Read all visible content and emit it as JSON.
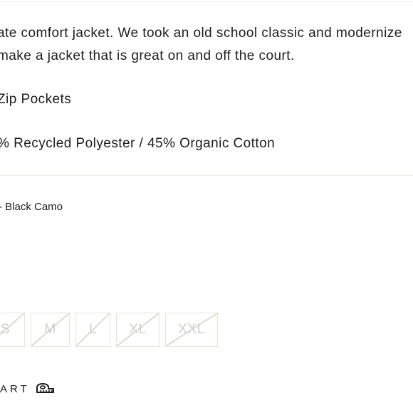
{
  "product": {
    "description_lines": [
      "ate comfort jacket.  We took an old school classic and modernize",
      "make a jacket that is great on and off the court.",
      "Zip Pockets",
      "% Recycled Polyester / 45% Organic Cotton"
    ],
    "color_label": "- Black Camo",
    "sizes": [
      {
        "label": "S",
        "available": false
      },
      {
        "label": "M",
        "available": false
      },
      {
        "label": "L",
        "available": false
      },
      {
        "label": "XL",
        "available": false
      },
      {
        "label": "XXL",
        "available": false
      }
    ],
    "size_chart_label": "ART",
    "size_chart_icon": "ruler-icon"
  }
}
